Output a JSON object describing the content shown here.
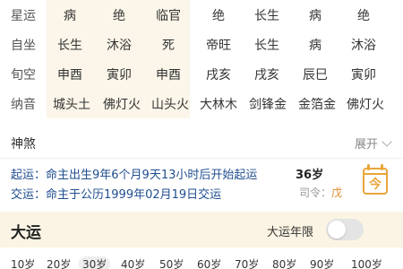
{
  "table": {
    "rows": [
      {
        "label": "星运",
        "cells": [
          "病",
          "绝",
          "临官",
          "绝",
          "长生",
          "病",
          "绝"
        ]
      },
      {
        "label": "自坐",
        "cells": [
          "长生",
          "沐浴",
          "死",
          "帝旺",
          "长生",
          "病",
          "沐浴"
        ]
      },
      {
        "label": "旬空",
        "cells": [
          "申酉",
          "寅卯",
          "申酉",
          "戌亥",
          "戌亥",
          "辰巳",
          "寅卯"
        ]
      },
      {
        "label": "纳音",
        "cells": [
          "城头土",
          "佛灯火",
          "山头火",
          "大林木",
          "剑锋金",
          "金箔金",
          "佛灯火"
        ]
      }
    ]
  },
  "shensha": {
    "label": "神煞",
    "expand_label": "展开"
  },
  "qiyun": {
    "text": "起运：命主出生9年6个月9天13小时后开始起运",
    "age": "36岁"
  },
  "jiaoyun": {
    "text": "交运：命主于公历1999年02月19日交运"
  },
  "siling": {
    "label": "司令：",
    "value": "戊"
  },
  "calendar_icon_char": "今",
  "dayun": {
    "title": "大运",
    "limit_label": "大运年限",
    "toggle_on": false
  },
  "ages": [
    "10岁",
    "20岁",
    "30岁",
    "40岁",
    "50岁",
    "60岁",
    "70岁",
    "80岁",
    "90岁",
    "100岁"
  ],
  "active_age_index": 2,
  "colors": {
    "highlight": "#fbf6e9",
    "accent": "#e9a53a",
    "link": "#1f4d8f"
  }
}
